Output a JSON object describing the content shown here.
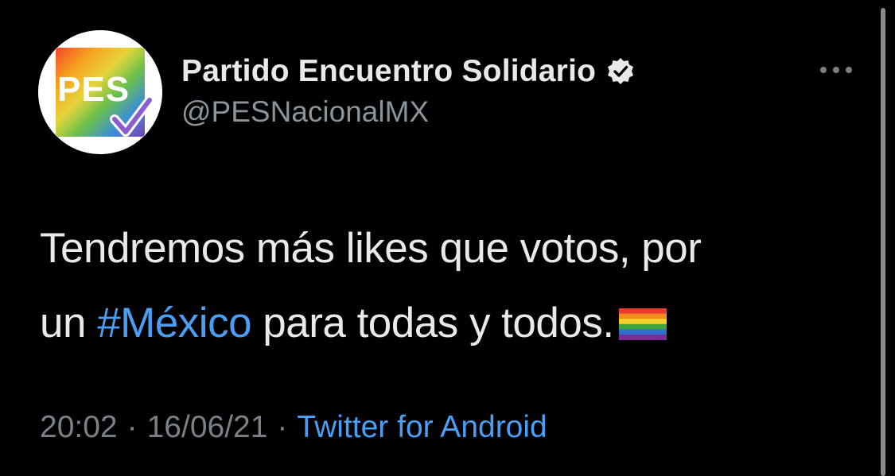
{
  "account": {
    "display_name": "Partido Encuentro Solidario",
    "handle": "@PESNacionalMX",
    "avatar_text": "PES",
    "verified_icon": "verified-badge-icon"
  },
  "tweet": {
    "line1": "Tendremos más likes que votos, por",
    "line2_prefix": "un ",
    "hashtag": "#México",
    "line2_suffix": " para todas y todos.",
    "emoji_icon": "rainbow-flag-icon"
  },
  "meta": {
    "time": "20:02",
    "separator": "·",
    "date": "16/06/21",
    "source": "Twitter for Android"
  },
  "menu": {
    "icon": "more-options-icon"
  },
  "colors": {
    "background": "#000000",
    "text_primary": "#e7e9ea",
    "text_secondary": "#8b949a",
    "link": "#4a9ff5"
  }
}
